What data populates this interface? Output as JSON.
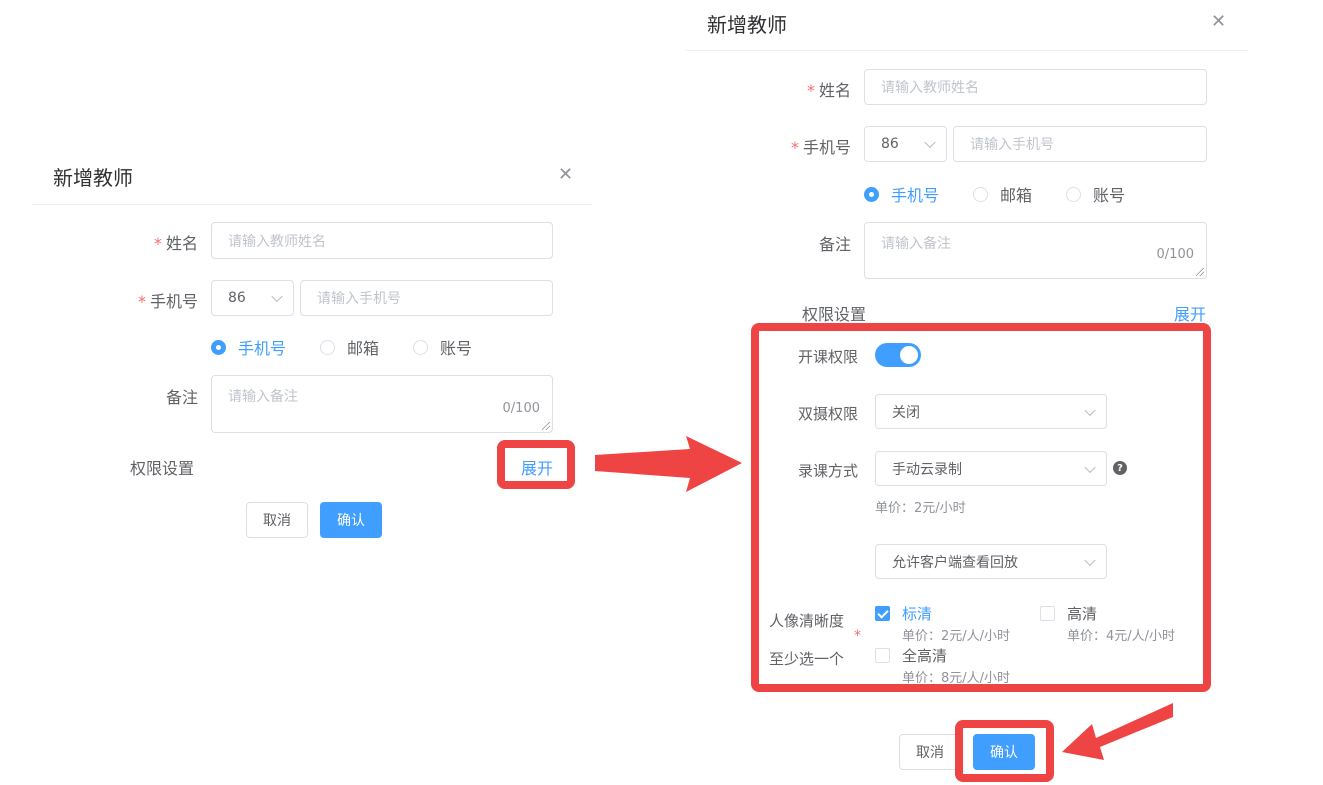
{
  "dialog": {
    "title": "新增教师",
    "close_icon": "close-icon",
    "name_label": "姓名",
    "name_placeholder": "请输入教师姓名",
    "phone_label": "手机号",
    "country_code": "86",
    "phone_placeholder": "请输入手机号",
    "account_types": [
      "手机号",
      "邮箱",
      "账号"
    ],
    "selected_account_type": "手机号",
    "remark_label": "备注",
    "remark_placeholder": "请输入备注",
    "remark_counter": "0/100",
    "permission_label": "权限设置",
    "expand_link": "展开",
    "cancel_button": "取消",
    "confirm_button": "确认"
  },
  "expanded": {
    "course_permission_label": "开课权限",
    "course_permission_on": true,
    "dual_camera_label": "双摄权限",
    "dual_camera_value": "关闭",
    "record_mode_label": "录课方式",
    "record_mode_value": "手动云录制",
    "record_price": "单价：2元/小时",
    "playback_value": "允许客户端查看回放",
    "clarity_label_1": "人像清晰度",
    "clarity_label_2": "至少选一个",
    "clarity_options": [
      {
        "label": "标清",
        "price": "单价：2元/人/小时",
        "checked": true
      },
      {
        "label": "高清",
        "price": "单价：4元/人/小时",
        "checked": false
      },
      {
        "label": "全高清",
        "price": "单价：8元/人/小时",
        "checked": false
      }
    ]
  },
  "colors": {
    "primary": "#409eff",
    "highlight": "#ef4444",
    "required": "#f56c6c"
  }
}
